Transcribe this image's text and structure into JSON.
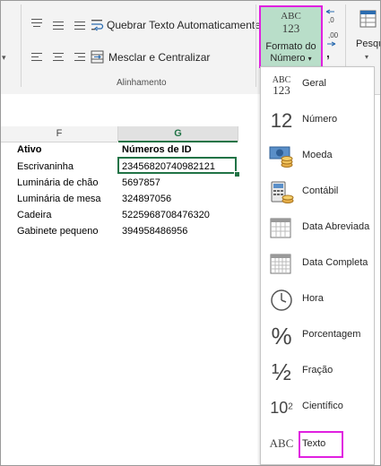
{
  "ribbon": {
    "wrap_text_label": "Quebrar Texto Automaticamente",
    "merge_center_label": "Mesclar e Centralizar",
    "group_label": "Alinhamento",
    "number_format_button": {
      "line1": "Formato do",
      "line2": "Número",
      "caret": "▾",
      "icon_top": "ABC",
      "icon_bottom": "123"
    },
    "search_partial": "Pesqu",
    "punctuation": ",",
    "highlight_color": "#e020e0",
    "active_fill_color": "#b9dec9"
  },
  "sheet": {
    "columns": [
      {
        "name": "F"
      },
      {
        "name": "G"
      }
    ],
    "active_column_color": "#217346",
    "headers": {
      "col_f": "Ativo",
      "col_g": "Números de ID"
    },
    "rows": [
      {
        "asset": "Escrivaninha",
        "id": "23456820740982121"
      },
      {
        "asset": "Luminária de chão",
        "id": "5697857"
      },
      {
        "asset": "Luminária de mesa",
        "id": "324897056"
      },
      {
        "asset": "Cadeira",
        "id": "5225968708476320"
      },
      {
        "asset": "Gabinete pequeno",
        "id": "394958486956"
      }
    ]
  },
  "dropdown": {
    "items": [
      {
        "label": "Geral",
        "icon": "general-icon"
      },
      {
        "label": "Número",
        "icon": "number-icon"
      },
      {
        "label": "Moeda",
        "icon": "currency-icon"
      },
      {
        "label": "Contábil",
        "icon": "accounting-icon"
      },
      {
        "label": "Data Abreviada",
        "icon": "short-date-icon"
      },
      {
        "label": "Data Completa",
        "icon": "long-date-icon"
      },
      {
        "label": "Hora",
        "icon": "time-icon"
      },
      {
        "label": "Porcentagem",
        "icon": "percentage-icon"
      },
      {
        "label": "Fração",
        "icon": "fraction-icon"
      },
      {
        "label": "Científico",
        "icon": "scientific-icon"
      },
      {
        "label": "Texto",
        "icon": "text-icon"
      }
    ],
    "glyphs": {
      "general_top": "ABC",
      "general_bottom": "123",
      "number": "12",
      "percent": "%",
      "fraction": "½",
      "sci_base": "10",
      "sci_exp": "2",
      "text": "ABC"
    }
  }
}
